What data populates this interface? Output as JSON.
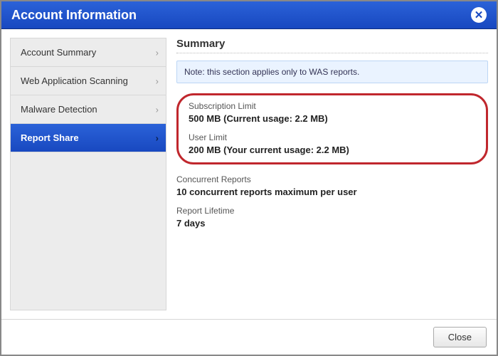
{
  "titlebar": {
    "title": "Account Information"
  },
  "sidebar": {
    "items": [
      {
        "label": "Account Summary"
      },
      {
        "label": "Web Application Scanning"
      },
      {
        "label": "Malware Detection"
      },
      {
        "label": "Report Share"
      }
    ],
    "active_index": 3
  },
  "content": {
    "heading": "Summary",
    "note": "Note: this section applies only to WAS reports.",
    "subscription_limit": {
      "label": "Subscription Limit",
      "value": "500 MB (Current usage: 2.2 MB)"
    },
    "user_limit": {
      "label": "User Limit",
      "value": "200 MB (Your current usage: 2.2 MB)"
    },
    "concurrent_reports": {
      "label": "Concurrent Reports",
      "value": "10 concurrent reports maximum per user"
    },
    "report_lifetime": {
      "label": "Report Lifetime",
      "value": "7 days"
    }
  },
  "footer": {
    "close_label": "Close"
  }
}
